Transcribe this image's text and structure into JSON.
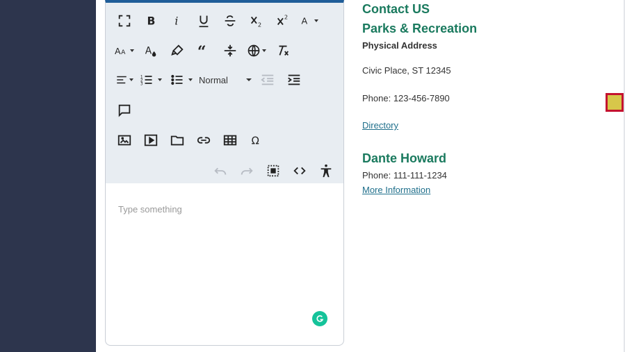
{
  "editor": {
    "format_value": "Normal",
    "placeholder": "Type something"
  },
  "contact": {
    "heading": "Contact US",
    "department": "Parks & Recreation",
    "address_label": "Physical Address",
    "address": "Civic Place, ST 12345",
    "phone": "Phone: 123-456-7890",
    "directory_link": "Directory",
    "person_name": "Dante Howard",
    "person_phone": "Phone: 111-111-1234",
    "more_info_link": "More Information"
  },
  "colors": {
    "sidebar": "#2d354d",
    "accent_green": "#1a7a5e",
    "link": "#1f6f8b",
    "editor_top_border": "#1f5d99"
  }
}
